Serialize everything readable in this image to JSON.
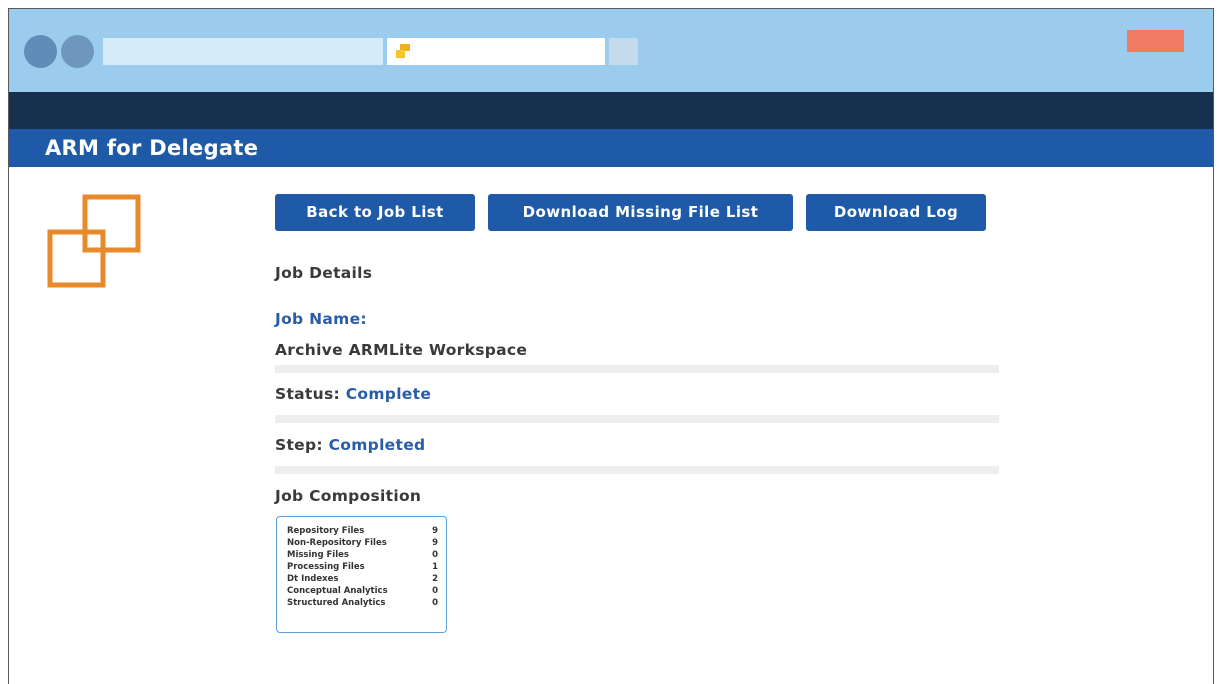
{
  "app": {
    "title": "ARM for Delegate"
  },
  "colors": {
    "brand_blue": "#1e5aa8",
    "accent_orange": "#e8892b",
    "chrome_blue": "#9ccced",
    "dark_band": "#17304d",
    "close_red": "#f07a63"
  },
  "toolbar": {
    "back_label": "Back to Job List",
    "download_missing_label": "Download Missing File List",
    "download_log_label": "Download Log"
  },
  "details": {
    "heading": "Job Details",
    "job_name_label": "Job Name:",
    "job_name_value": "Archive ARMLite Workspace",
    "status_label": "Status:",
    "status_value": "Complete",
    "step_label": "Step:",
    "step_value": "Completed"
  },
  "composition": {
    "heading": "Job Composition",
    "rows": [
      {
        "label": "Repository Files",
        "value": "9"
      },
      {
        "label": "Non-Repository Files",
        "value": "9"
      },
      {
        "label": "Missing Files",
        "value": "0"
      },
      {
        "label": "Processing Files",
        "value": "1"
      },
      {
        "label": "Dt Indexes",
        "value": "2"
      },
      {
        "label": "Conceptual Analytics",
        "value": "0"
      },
      {
        "label": "Structured Analytics",
        "value": "0"
      }
    ]
  },
  "icons": {
    "logo": "overlapping-squares-logo",
    "address_icon": "site-favicon"
  }
}
